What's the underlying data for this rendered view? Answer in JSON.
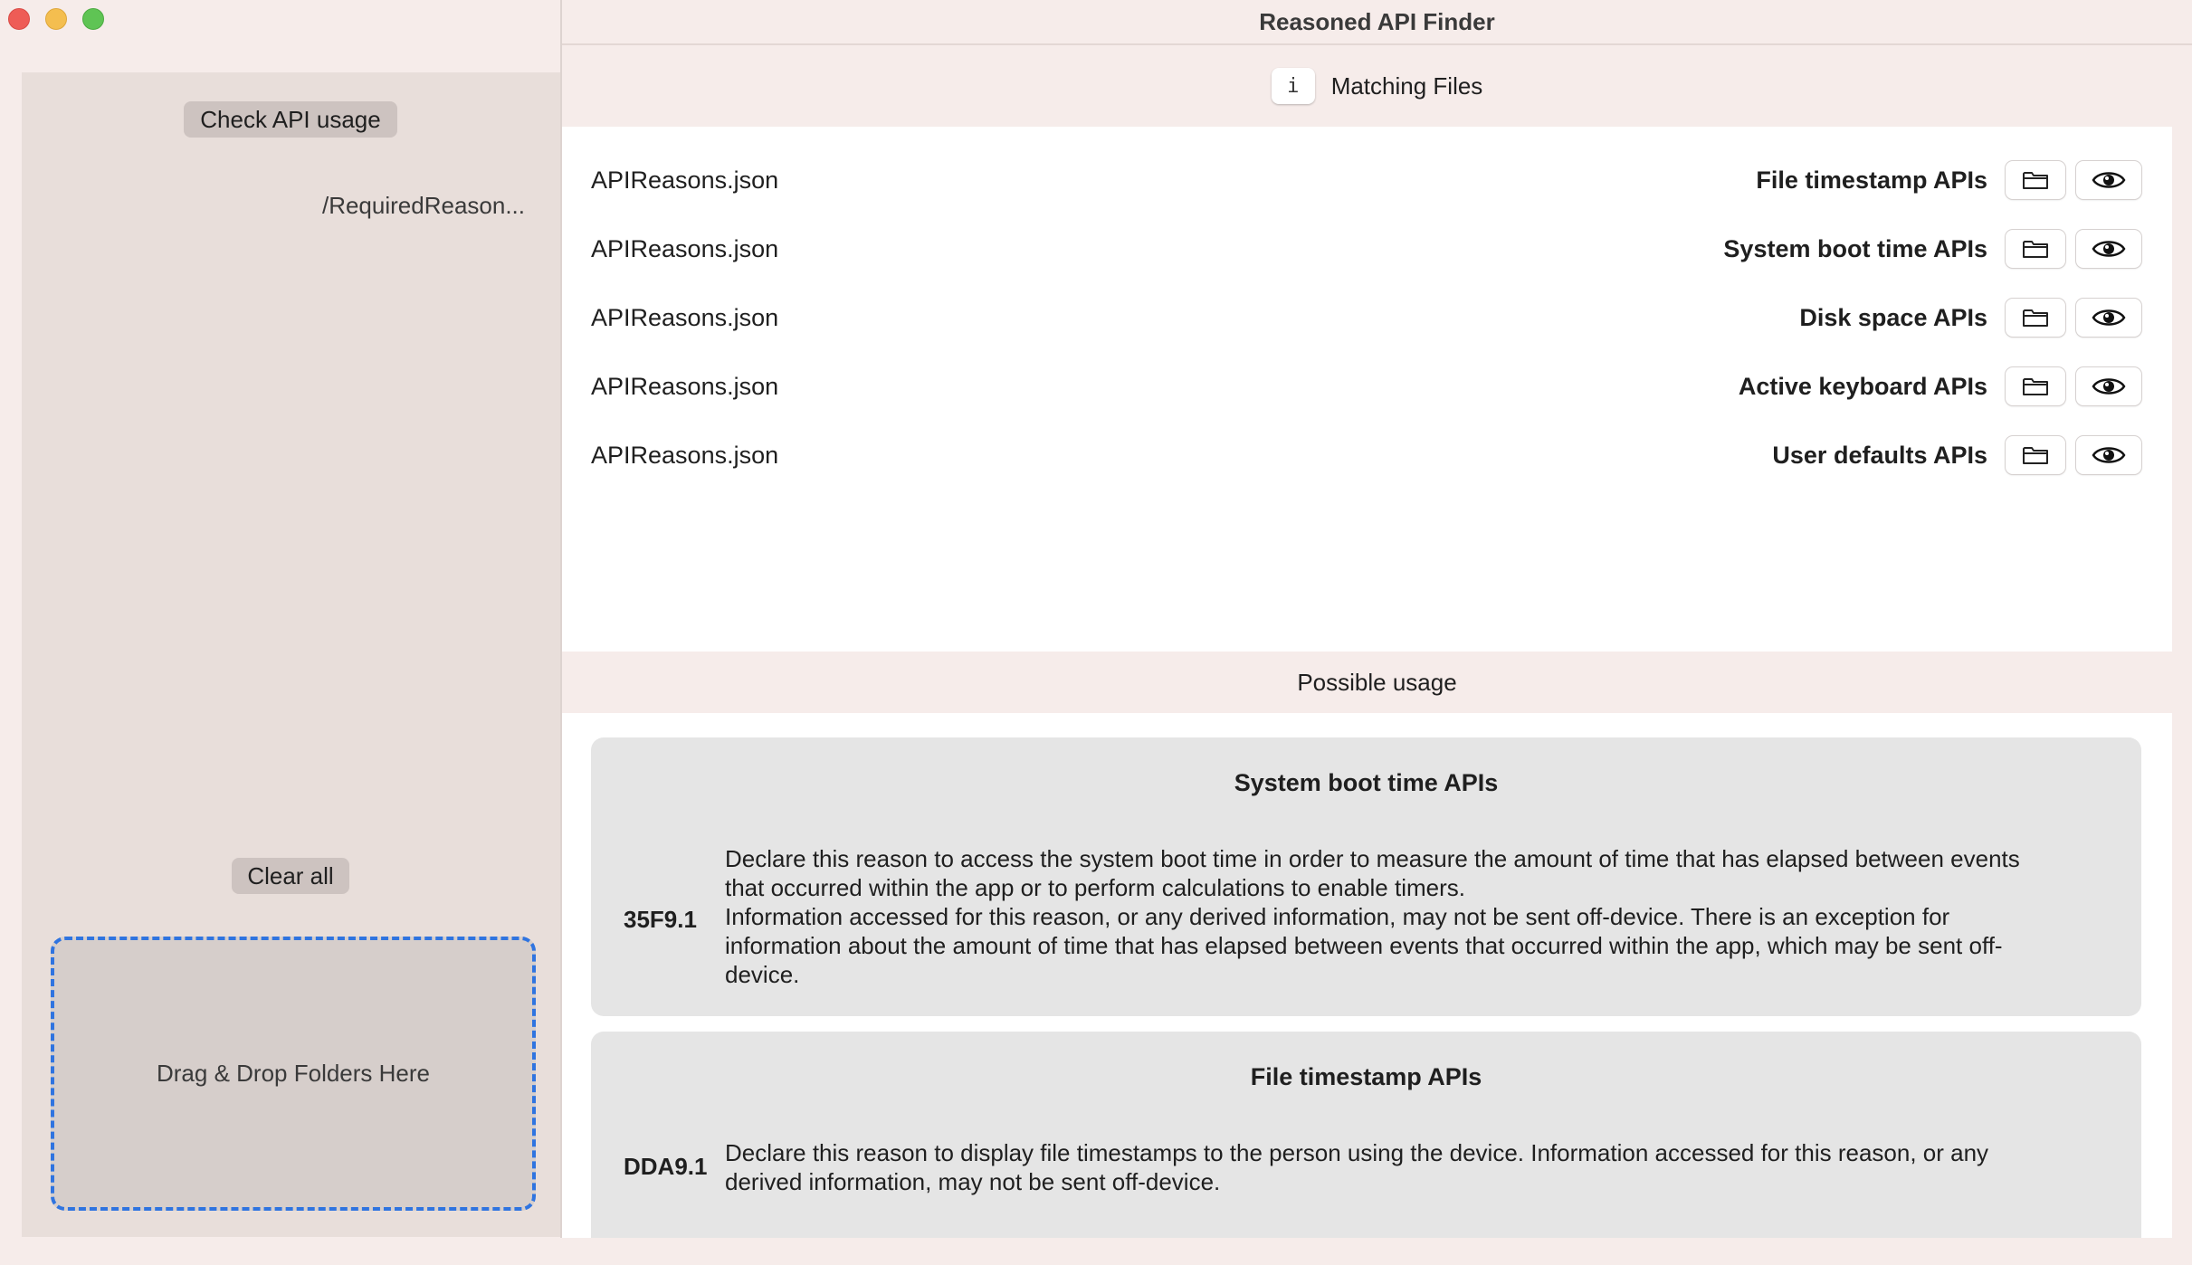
{
  "window": {
    "title": "Reasoned API Finder"
  },
  "sidebar": {
    "check_button": "Check API usage",
    "path": "/RequiredReason...",
    "clear_button": "Clear all",
    "drop_zone": "Drag & Drop Folders Here"
  },
  "matching_files": {
    "info_button": "i",
    "title": "Matching Files",
    "rows": [
      {
        "file": "APIReasons.json",
        "category": "File timestamp APIs"
      },
      {
        "file": "APIReasons.json",
        "category": "System boot time APIs"
      },
      {
        "file": "APIReasons.json",
        "category": "Disk space APIs"
      },
      {
        "file": "APIReasons.json",
        "category": "Active keyboard APIs"
      },
      {
        "file": "APIReasons.json",
        "category": "User defaults APIs"
      }
    ],
    "row_icons": [
      "folder-icon",
      "eye-icon"
    ]
  },
  "possible_usage": {
    "title": "Possible usage",
    "cards": [
      {
        "title": "System boot time APIs",
        "code": "35F9.1",
        "lines": [
          "Declare this reason to access the system boot time in order to measure the amount of time that has elapsed between events",
          "that occurred within the app or to perform calculations to enable timers.",
          "Information accessed for this reason, or any derived information, may not be sent off-device. There is an exception for",
          "information about the amount of time that has elapsed between events that occurred within the app, which may be sent off-",
          "device."
        ]
      },
      {
        "title": "File timestamp APIs",
        "code": "DDA9.1",
        "lines": [
          "Declare this reason to display file timestamps to the person using the device. Information accessed for this reason, or any",
          "derived information, may not be sent off-device."
        ]
      }
    ]
  },
  "colors": {
    "accent_dashed": "#2f74e0",
    "close": "#ee5c56",
    "minimize": "#f4be4f",
    "maximize": "#5fc454"
  }
}
